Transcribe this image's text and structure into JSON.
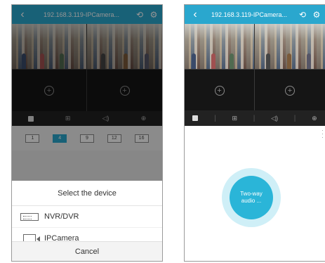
{
  "left_phone": {
    "header": {
      "title": "192.168.3.119-IPCamera..."
    },
    "split_options": [
      "1",
      "4",
      "9",
      "12",
      "16"
    ],
    "device_sheet": {
      "title": "Select the device",
      "items": [
        {
          "label": "NVR/DVR",
          "icon": "nvr-icon"
        },
        {
          "label": "IPCamera",
          "icon": "camera-icon"
        }
      ],
      "cancel_label": "Cancel"
    }
  },
  "right_phone": {
    "header": {
      "title": "192.168.3.119-IPCamera..."
    },
    "talk_button_label": "Two-way audio ..."
  },
  "colors": {
    "accent": "#2aa7ce",
    "talk": "#2ab5d8",
    "talk_ring": "#cfeff7",
    "control_bar": "#222222"
  }
}
